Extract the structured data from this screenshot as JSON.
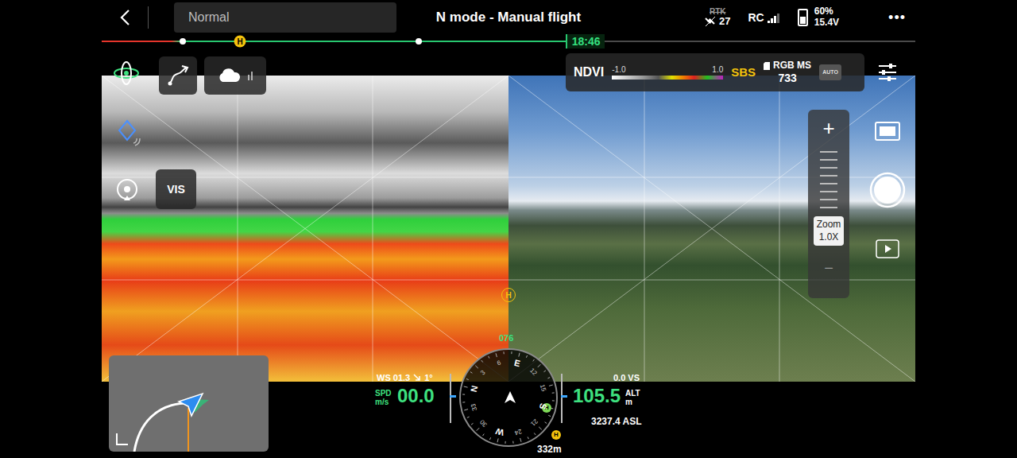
{
  "top_bar": {
    "mode_select": "Normal",
    "title": "N mode - Manual flight",
    "rtk": {
      "label": "RTK",
      "disabled": true
    },
    "satellites": "27",
    "rc": {
      "label": "RC",
      "level": 0.75
    },
    "battery": {
      "percent": "60%",
      "voltage": "15.4V",
      "level": 0.6
    },
    "more": "•••"
  },
  "timeline": {
    "time": "18:46",
    "level": 0.57,
    "markers": [
      {
        "kind": "dot",
        "level": 0.1
      },
      {
        "kind": "home",
        "label": "H",
        "level": 0.17
      },
      {
        "kind": "dot",
        "level": 0.39
      }
    ]
  },
  "camera_panel": {
    "index": "NDVI",
    "scale_min": "-1.0",
    "scale_max": "1.0",
    "display_mode": "SBS",
    "lens": "RGB MS",
    "remaining": "733",
    "exposure": "AUTO"
  },
  "vis_button": "VIS",
  "views": [
    {
      "kind": "ndvi"
    },
    {
      "kind": "rgb"
    }
  ],
  "image_home_marker": "H",
  "zoom": {
    "plus": "+",
    "label": "Zoom",
    "value": "1.0X",
    "minus": "−"
  },
  "telemetry": {
    "wind": "WS 01.3",
    "wind_angle": "1°",
    "speed_label": "SPD",
    "speed_unit": "m/s",
    "speed": "00.0",
    "altitude": "105.5",
    "altitude_label": "ALT",
    "altitude_unit": "m",
    "vertical_speed": "0.0 VS",
    "asl": "3237.4 ASL",
    "home_distance": "332m",
    "home_marker": "H",
    "heading": "076"
  },
  "compass": {
    "home_marker": "H",
    "labels": [
      "N",
      "3",
      "6",
      "E",
      "12",
      "15",
      "S",
      "21",
      "24",
      "W",
      "30",
      "33"
    ]
  }
}
